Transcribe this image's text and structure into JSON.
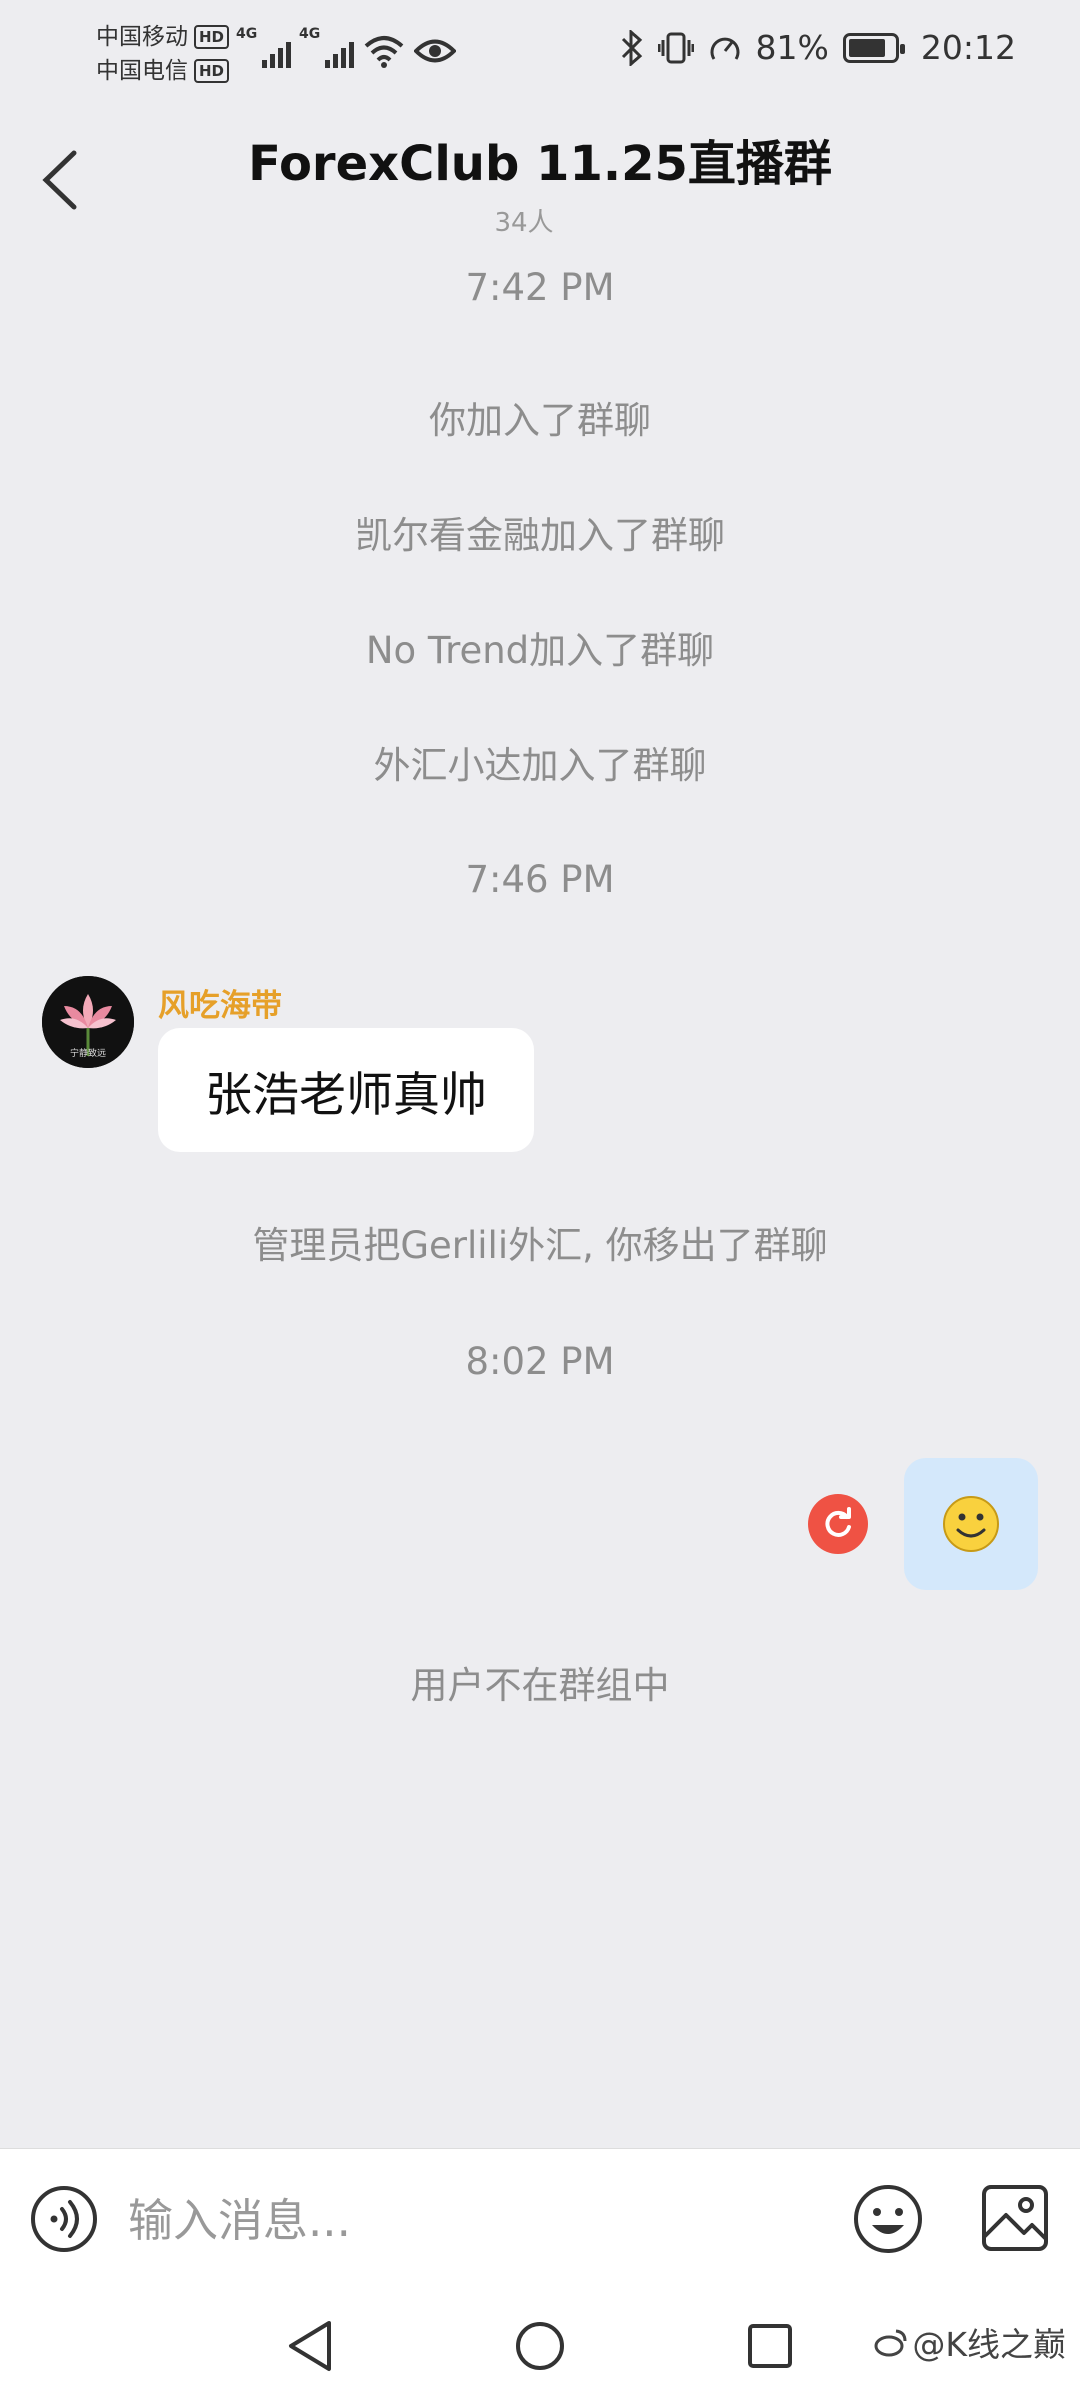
{
  "status_bar": {
    "carrier_1": "中国移动",
    "carrier_2": "中国电信",
    "hd": "HD",
    "network_1": "4G",
    "network_2": "4G",
    "battery_percent": "81%",
    "battery_level": 0.81,
    "time": "20:12"
  },
  "header": {
    "title": "ForexClub 11.25直播群",
    "member_count": "34人"
  },
  "messages": {
    "time_1": "7:42 PM",
    "sys_1": "你加入了群聊",
    "sys_2": "凯尔看金融加入了群聊",
    "sys_3": "No Trend加入了群聊",
    "sys_4": "外汇小达加入了群聊",
    "time_2": "7:46 PM",
    "incoming": {
      "sender": "风吃海带",
      "avatar_caption": "宁静致远",
      "text": "张浩老师真帅"
    },
    "sys_5": "管理员把Gerlili外汇, 你移出了群聊",
    "time_3": "8:02 PM",
    "outgoing": {
      "emoji": "🙂"
    },
    "sys_6": "用户不在群组中"
  },
  "input_bar": {
    "placeholder": "输入消息..."
  },
  "watermark": "@K线之巅",
  "colors": {
    "background": "#ededf0",
    "sender_name": "#e6a029",
    "resend": "#ef5244",
    "outgoing_bubble": "#d4e8fb"
  },
  "icons": [
    "back-arrow-icon",
    "voice-icon",
    "emoji-icon",
    "image-icon",
    "nav-back-icon",
    "nav-home-icon",
    "nav-recent-icon",
    "resend-icon"
  ]
}
